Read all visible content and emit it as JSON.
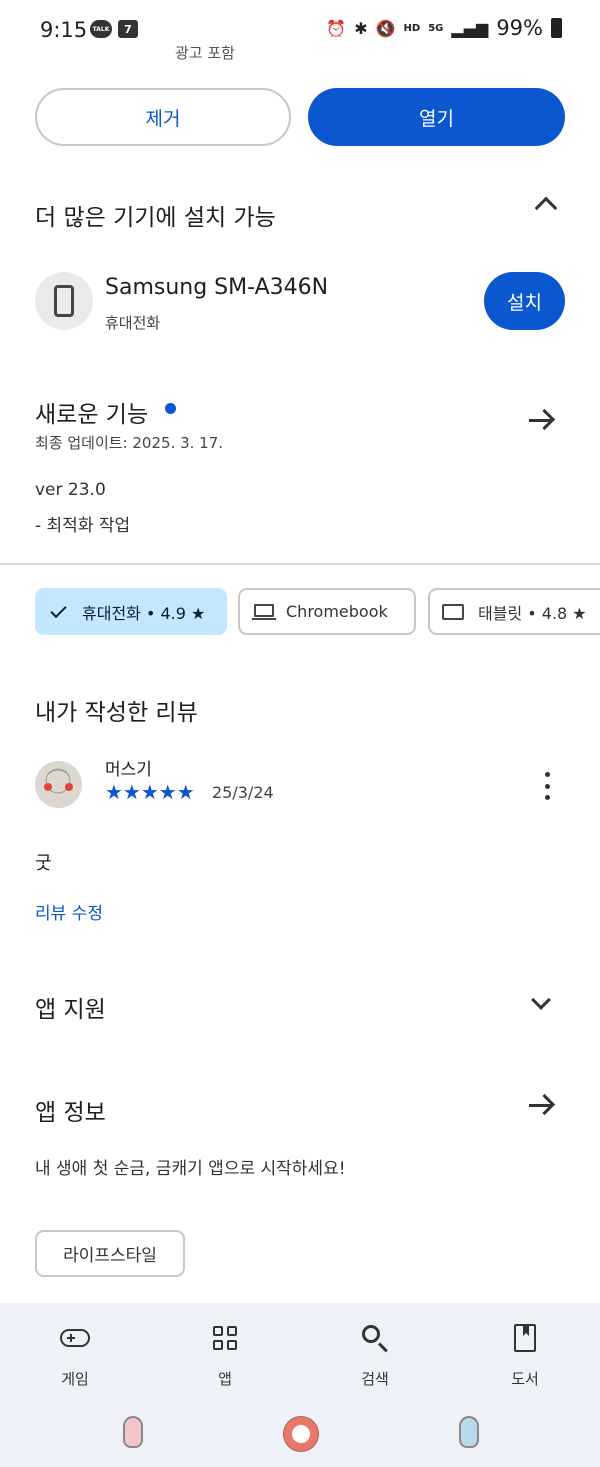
{
  "status": {
    "time": "9:15",
    "talk_icon_text": "TALK",
    "seven_icon_text": "7",
    "hd_text": "HD",
    "fiveg_text": "5G",
    "battery": "99%"
  },
  "top_cut_text": "광고 포함",
  "actions": {
    "remove_label": "제거",
    "open_label": "열기"
  },
  "devices": {
    "title": "더 많은 기기에 설치 가능",
    "device_name": "Samsung SM-A346N",
    "device_type": "휴대전화",
    "install_label": "설치"
  },
  "whats_new": {
    "title": "새로운 기능",
    "last_update": "최종 업데이트: 2025. 3. 17.",
    "version": "ver 23.0",
    "note": "- 최적화 작업"
  },
  "filter_chips": {
    "phone": "휴대전화 • 4.9 ★",
    "chromebook": "Chromebook",
    "tablet": "태블릿 • 4.8 ★"
  },
  "my_review": {
    "title": "내가 작성한 리뷰",
    "reviewer": "머스기",
    "stars": "★★★★★",
    "rating": 5,
    "date": "25/3/24",
    "text": "굿",
    "edit_label": "리뷰 수정"
  },
  "app_support": {
    "title": "앱 지원"
  },
  "app_info": {
    "title": "앱 정보",
    "description": "내 생애 첫 순금, 금캐기 앱으로 시작하세요!",
    "tag": "라이프스타일"
  },
  "bottom_nav": {
    "games": "게임",
    "apps": "앱",
    "search": "검색",
    "books": "도서"
  },
  "colors": {
    "accent": "#0b57d0",
    "chip_selected_bg": "#c2e7ff",
    "nav_bg": "#eef2f8"
  }
}
